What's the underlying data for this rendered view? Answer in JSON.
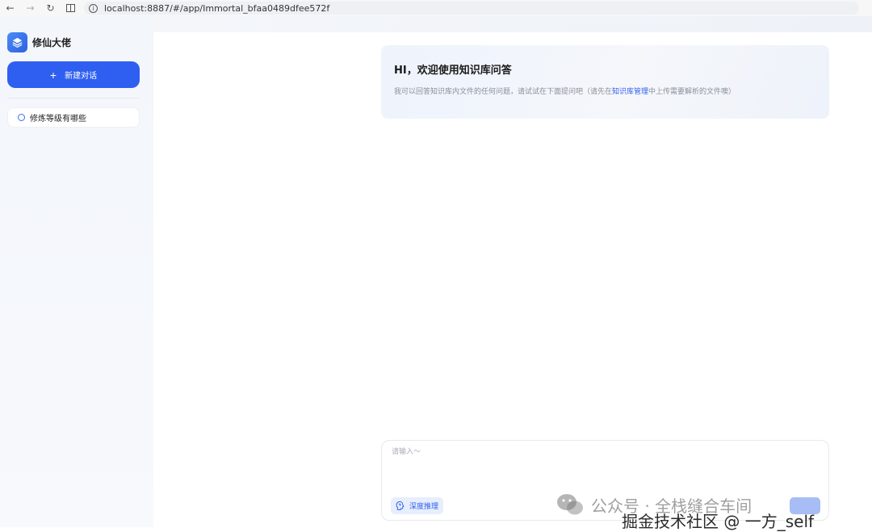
{
  "browser": {
    "url": "localhost:8887/#/app/Immortal_bfaa0489dfee572f"
  },
  "sidebar": {
    "brand_title": "修仙大佬",
    "new_chat_label": "新建对话",
    "history": [
      {
        "label": "修炼等级有哪些"
      }
    ]
  },
  "welcome": {
    "title": "HI，欢迎使用知识库问答",
    "desc_before": "我可以回答知识库内文件的任何问题，请试试在下面提问吧（请先在",
    "desc_link": "知识库管理",
    "desc_after": "中上传需要解析的文件噢）"
  },
  "input": {
    "placeholder": "请输入～",
    "deep_reasoning_label": "深度推理"
  },
  "watermark": {
    "line1": "公众号 · 全栈缝合车间",
    "line2": "掘金技术社区 @ 一方_self"
  },
  "colors": {
    "accent": "#2f5ff0",
    "send_disabled": "#a8bdf5"
  }
}
